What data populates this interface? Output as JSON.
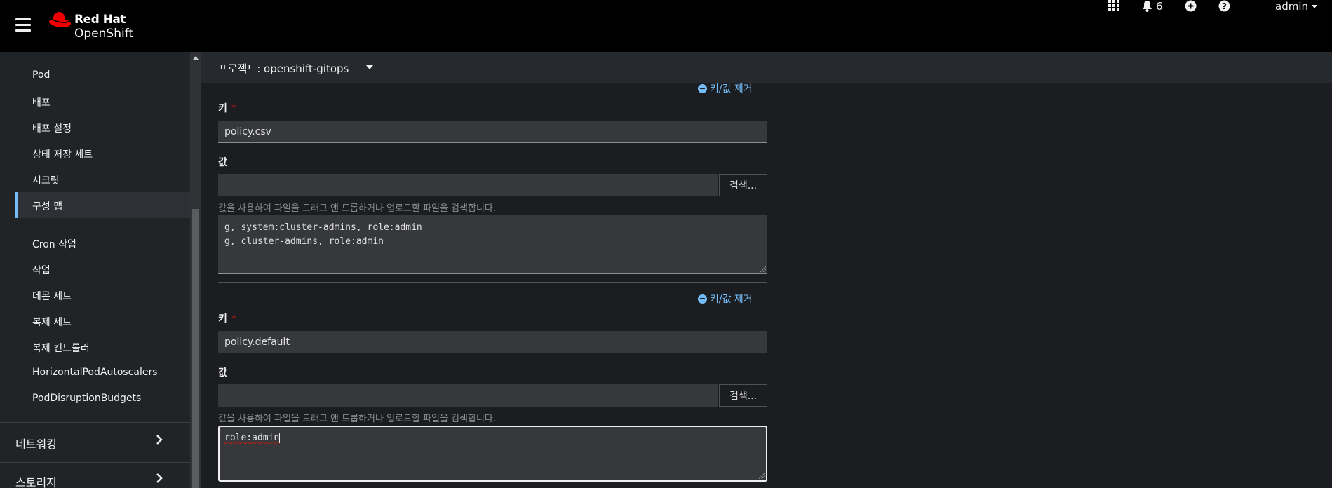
{
  "masthead": {
    "brand_line1": "Red Hat",
    "brand_line2": "OpenShift",
    "notification_count": "6",
    "user_name": "admin"
  },
  "sidebar": {
    "items": [
      {
        "label": "Pod"
      },
      {
        "label": "배포"
      },
      {
        "label": "배포 설정"
      },
      {
        "label": "상태 저장 세트"
      },
      {
        "label": "시크릿"
      },
      {
        "label": "구성 맵",
        "active": true
      },
      {
        "label": "Cron 작업"
      },
      {
        "label": "작업"
      },
      {
        "label": "데몬 세트"
      },
      {
        "label": "복제 세트"
      },
      {
        "label": "복제 컨트롤러"
      },
      {
        "label": "HorizontalPodAutoscalers"
      },
      {
        "label": "PodDisruptionBudgets"
      }
    ],
    "sections": [
      {
        "label": "네트워킹"
      },
      {
        "label": "스토리지"
      }
    ]
  },
  "project_bar": {
    "label": "프로젝트: openshift-gitops"
  },
  "form": {
    "remove_label": "키/값 제거",
    "key_label": "키",
    "required_mark": "*",
    "value_label": "값",
    "browse_label": "검색...",
    "helper_text": "값을 사용하여 파일을 드래그 앤 드롭하거나 업로드할 파일을 검색합니다.",
    "entries": [
      {
        "key": "policy.csv",
        "value_line1": "g, system:cluster-admins, role:admin",
        "value_line2": "g, cluster-admins, role:admin"
      },
      {
        "key": "policy.default",
        "value_line1": "role:admin"
      }
    ]
  },
  "colors": {
    "link": "#73bcf7",
    "required": "#c9190b",
    "brand_red": "#ee0000"
  }
}
